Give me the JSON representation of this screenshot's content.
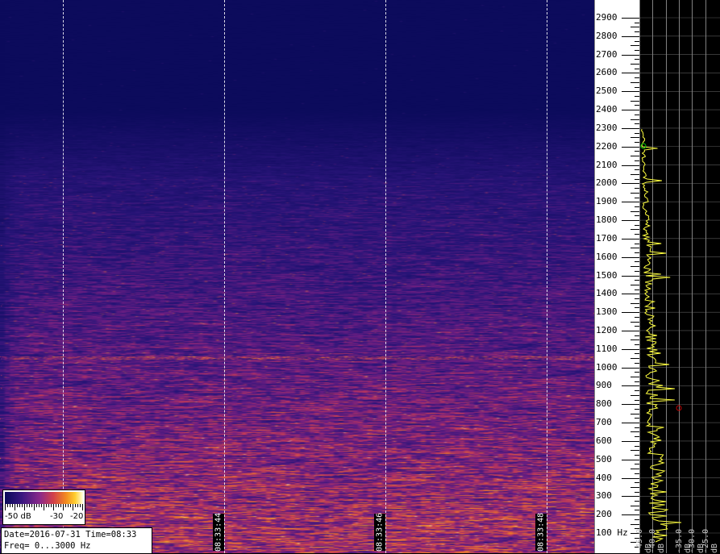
{
  "window": {
    "title": ""
  },
  "spectrogram": {
    "time_labels": [
      "08:33:44",
      "08:33:46",
      "08:33:48"
    ]
  },
  "freq_axis": {
    "labels": [
      "2900",
      "2800",
      "2700",
      "2600",
      "2500",
      "2400",
      "2300",
      "2200",
      "2100",
      "2000",
      "1900",
      "1800",
      "1700",
      "1600",
      "1500",
      "1400",
      "1300",
      "1200",
      "1100",
      "1000",
      "900",
      "800",
      "700",
      "600",
      "500",
      "400",
      "300",
      "200",
      "100 Hz"
    ]
  },
  "spectrum_panel": {
    "db_labels": [
      "-45.0 dB",
      "-40.0 dB",
      "-35.0 dB",
      "-30.0 dB",
      "-25.0 dB"
    ],
    "trace_color": "#ffff40",
    "grid_color": "#808080",
    "marker_green": "#00c800",
    "marker_red": "#c00000"
  },
  "colorbar": {
    "labels": [
      "-50 dB",
      "-30",
      "-20"
    ]
  },
  "info": {
    "line1": "Date=2016-07-31 Time=08:33",
    "line2": "Freq= 0...3000 Hz"
  },
  "colors": {
    "background": "#0a0a5a",
    "axis_bg": "#ffffff"
  }
}
